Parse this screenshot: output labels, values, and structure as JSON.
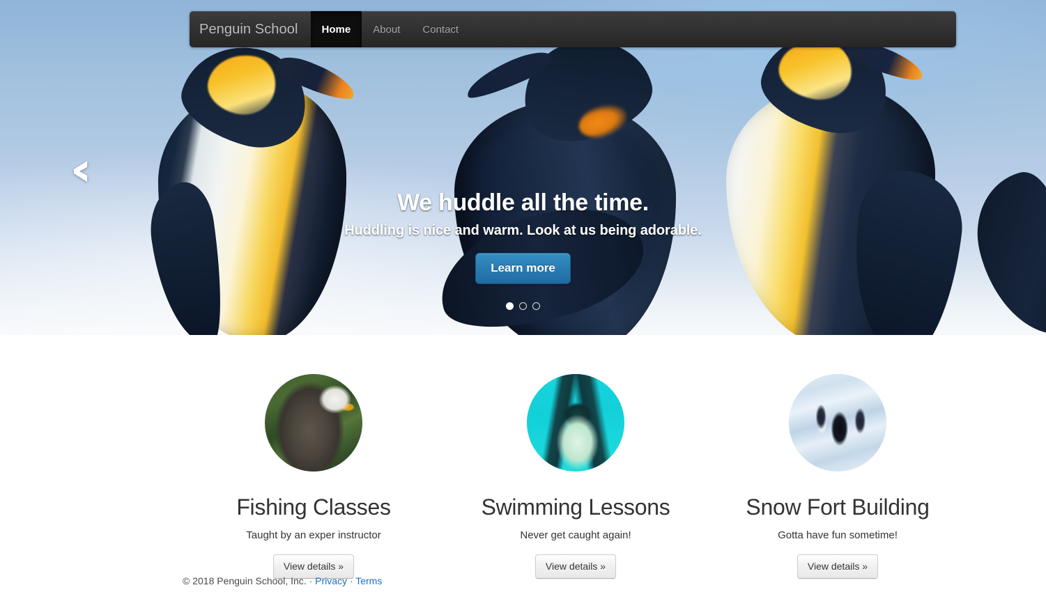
{
  "navbar": {
    "brand": "Penguin School",
    "items": [
      {
        "label": "Home",
        "active": true
      },
      {
        "label": "About",
        "active": false
      },
      {
        "label": "Contact",
        "active": false
      }
    ]
  },
  "hero": {
    "scene": "king-penguins-huddling",
    "prev_icon": "chevron-left-icon",
    "title": "We huddle all the time.",
    "subtitle": "Huddling is nice and warm. Look at us being adorable.",
    "cta_label": "Learn more",
    "cta_color": "#2a7cb0",
    "indicators": [
      {
        "active": true
      },
      {
        "active": false
      },
      {
        "active": false
      }
    ]
  },
  "features": [
    {
      "image": "bald-eagle-photo",
      "title": "Fishing Classes",
      "description": "Taught by an exper instructor",
      "button_label": "View details »"
    },
    {
      "image": "swimming-penguin-photo",
      "title": "Swimming Lessons",
      "description": "Never get caught again!",
      "button_label": "View details »"
    },
    {
      "image": "penguins-on-snow-photo",
      "title": "Snow Fort Building",
      "description": "Gotta have fun sometime!",
      "button_label": "View details »"
    }
  ],
  "footer": {
    "copyright": "© 2018 Penguin School, Inc.",
    "sep1": "·",
    "privacy": "Privacy",
    "sep2": "·",
    "terms": "Terms",
    "link_color": "#1f6fc4"
  }
}
